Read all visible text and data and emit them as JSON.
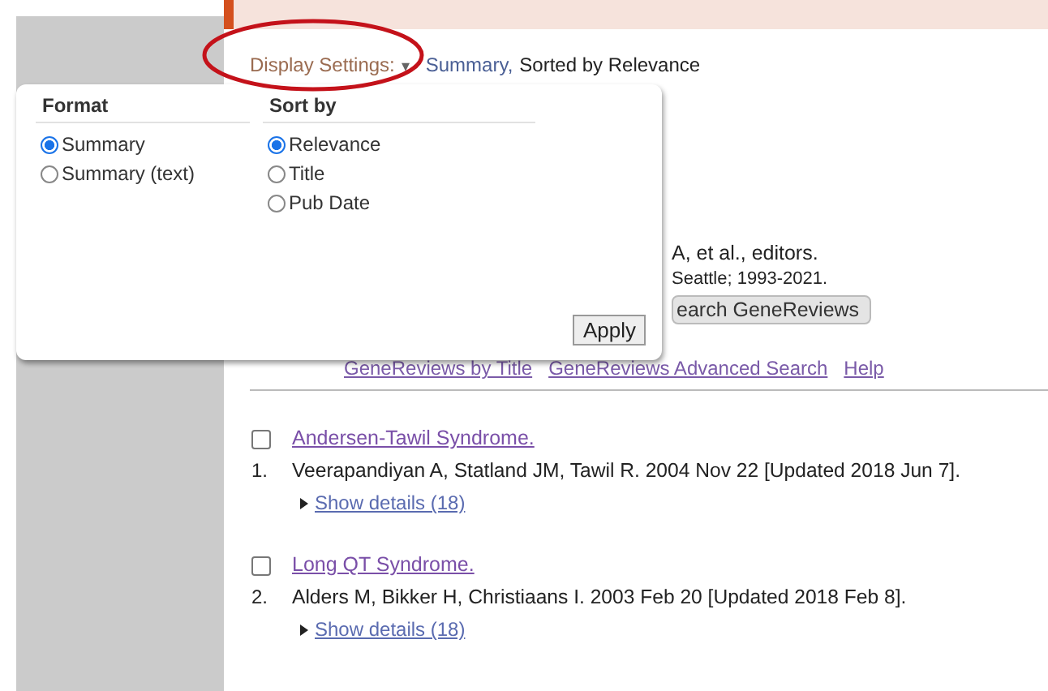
{
  "display_settings": {
    "label": "Display Settings:",
    "caret": "▾",
    "format_link": "Summary,",
    "sort_text": "Sorted by Relevance"
  },
  "book": {
    "editors": "A, et al., editors.",
    "publisher": "Seattle; 1993-2021.",
    "search_button": "earch GeneReviews",
    "links": [
      "GeneReviews by Title",
      "GeneReviews Advanced Search",
      "Help"
    ]
  },
  "results": [
    {
      "number": "1.",
      "title": "Andersen-Tawil Syndrome.",
      "checked": false,
      "citation": "Veerapandiyan A, Statland JM, Tawil R. 2004 Nov 22 [Updated 2018 Jun 7].",
      "details": "Show details (18)"
    },
    {
      "number": "2.",
      "title": "Long QT Syndrome.",
      "checked": false,
      "citation": "Alders M, Bikker H, Christiaans I. 2003 Feb 20 [Updated 2018 Feb 8].",
      "details": "Show details (18)"
    }
  ],
  "popup": {
    "format": {
      "heading": "Format",
      "options": [
        {
          "label": "Summary",
          "selected": true
        },
        {
          "label": "Summary (text)",
          "selected": false
        }
      ]
    },
    "sort": {
      "heading": "Sort by",
      "options": [
        {
          "label": "Relevance",
          "selected": true
        },
        {
          "label": "Title",
          "selected": false
        },
        {
          "label": "Pub Date",
          "selected": false
        }
      ]
    },
    "apply": "Apply"
  },
  "annotation": {
    "kind": "ellipse"
  }
}
